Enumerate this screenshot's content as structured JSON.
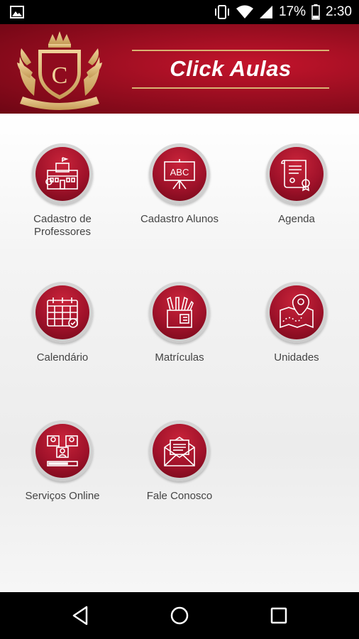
{
  "status_bar": {
    "battery_percent": "17%",
    "time": "2:30",
    "icons": [
      "gallery-icon",
      "vibrate-icon",
      "wifi-icon",
      "signal-icon",
      "battery-icon"
    ]
  },
  "header": {
    "title": "Click Aulas",
    "crest_letter": "C"
  },
  "menu": {
    "items": [
      {
        "label": "Cadastro de Professores",
        "icon": "school-building-icon"
      },
      {
        "label": "Cadastro Alunos",
        "icon": "blackboard-abc-icon"
      },
      {
        "label": "Agenda",
        "icon": "certificate-scroll-icon"
      },
      {
        "label": "Calendário",
        "icon": "calendar-icon"
      },
      {
        "label": "Matrículas",
        "icon": "pencil-cup-icon"
      },
      {
        "label": "Unidades",
        "icon": "map-pin-icon"
      },
      {
        "label": "Serviços Online",
        "icon": "online-users-icon"
      },
      {
        "label": "Fale Conosco",
        "icon": "envelope-icon"
      }
    ]
  },
  "nav_bar": {
    "icons": [
      "back-icon",
      "home-icon",
      "recents-icon"
    ]
  },
  "colors": {
    "header_red": "#9c0e21",
    "accent_gold": "#d9b373",
    "icon_red": "#a0122a"
  }
}
